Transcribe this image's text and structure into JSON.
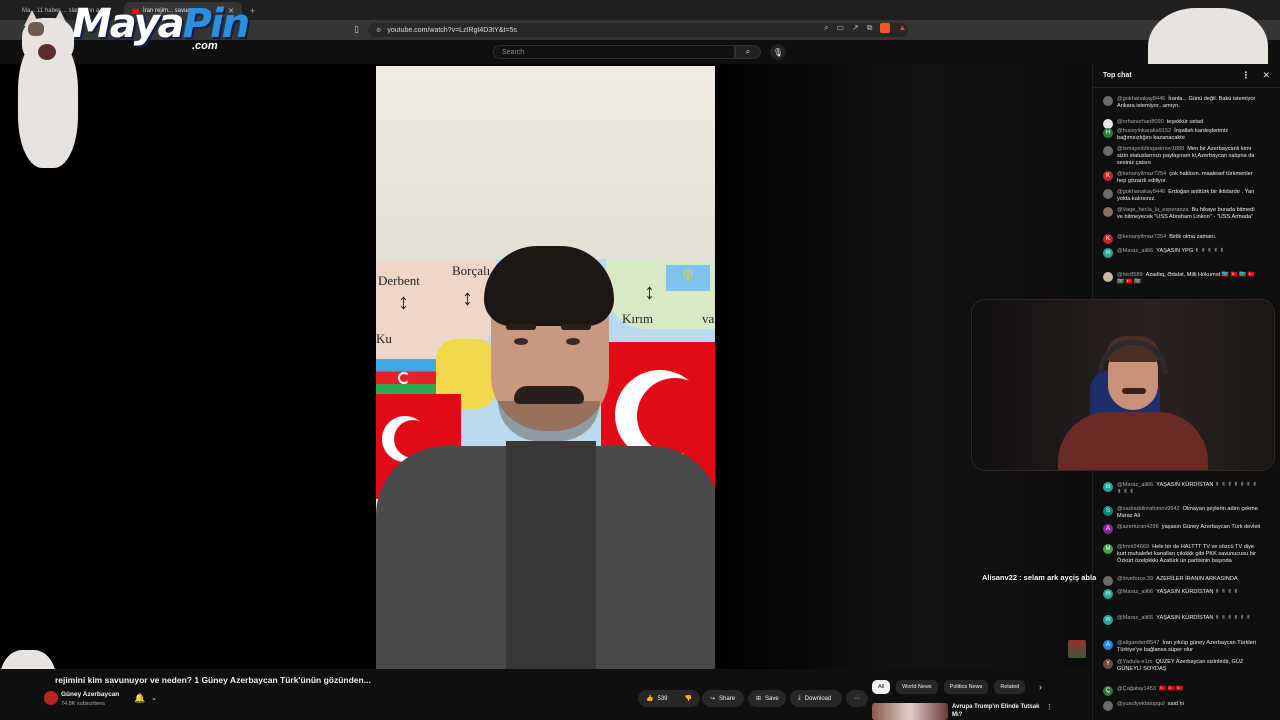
{
  "browser": {
    "tabs": [
      {
        "label": "Ma... 11 haber ... slam alan a..."
      },
      {
        "label": "İran rejim... savunuyor v..."
      }
    ],
    "new_tab": "+",
    "url": "youtube.com/watch?v=LzIRgt4D3tY&t=5s"
  },
  "overlay": {
    "logo_main": "Maya",
    "logo_accent": "Pin",
    "logo_sub": ".com",
    "alert_text": "Alisanv22 : selam ark ayçiş abla"
  },
  "youtube": {
    "search_placeholder": "Search",
    "video": {
      "map_labels": [
        "Derbent",
        "Borçalı",
        "Kırım",
        "Ku",
        "va"
      ]
    },
    "title": "rejimini kim savunuyor ve neden? 1 Güney Azerbaycan Türk'ünün gözünden...",
    "channel_name": "Güney Azerbaycan",
    "subscribers": "74.8K subscribers",
    "like_count": "539",
    "share_label": "Share",
    "save_label": "Save",
    "download_label": "Download",
    "more_label": "⋯",
    "chips": [
      "All",
      "World News",
      "Politics News",
      "Related"
    ],
    "rec_title": "Avrupa Trump'ın Elinde Tutsak Mı?"
  },
  "chat": {
    "header": "Top chat",
    "messages": [
      {
        "author": "@gokhanakay8446",
        "text": "İranla... Günü değil. Bakü istemiyor Ankara istemiyor...amıyn.",
        "color": "#6b6b6b",
        "initial": ""
      },
      {
        "author": "@orhanorhan8090",
        "text": "teşekkür ustad",
        "color": "#e8e8e8",
        "initial": ""
      },
      {
        "author": "@huseyinkaraka9152",
        "text": "İnşallah kardeşlerimiz bağımsızlığını kazanacaktır.",
        "color": "#2e7d32",
        "initial": "H"
      },
      {
        "author": "@ismayeddinqasimov1888",
        "text": "Men bir Azerbaycanlı kimi sizin statuslarınızı paylaşıram ki,Azerbaycan xalqına da sesiniz çatsın",
        "color": "#6b6b6b",
        "initial": ""
      },
      {
        "author": "@kenanyilmaz7254",
        "text": "çok haklısın. maalesef türkmenler hep gözardı ediliyor.",
        "color": "#c62828",
        "initial": "K"
      },
      {
        "author": "@gokhanakay8446",
        "text": "Erdoğan antitürk bir iktidardır . Yan yolda kalırsınız.",
        "color": "#6b6b6b",
        "initial": ""
      },
      {
        "author": "@Vaqe_hecla_la_esperanza",
        "text": "Bu hikaye burada bitmedi ve bitmeyecek \"USS Abraham Linkon\" - \"USS Armada\"",
        "color": "#8d6e63",
        "initial": ""
      },
      {
        "author": "@kenanyilmaz7254",
        "text": "Birlik olma zamanı.",
        "color": "#c62828",
        "initial": "K"
      },
      {
        "author": "@Maraz_ali66",
        "text": "YAŞASIN YPG ✌ ✌ ✌ ✌ ✌",
        "color": "#26a69a",
        "initial": "m"
      },
      {
        "author": "@htc8589",
        "text": "Azadlıq, Ədalət, Milli Hökumət 🇦🇿 🇹🇷 🇦🇿 🇹🇷 🇦🇿 🇹🇷 🇦🇿",
        "color": "#c9b89a",
        "initial": ""
      },
      {
        "author": "@Maraz_ali66",
        "text": "YAŞASIN KÜRDİSTAN ✌ ✌ ✌ ✌ ✌ ✌ ✌ ✌ ✌ ✌",
        "color": "#26a69a",
        "initial": "m"
      },
      {
        "author": "@sadraddinrahimov9542",
        "text": "Olmayan şeylerin adını çekme Maraz Ali",
        "color": "#00897b",
        "initial": "S"
      },
      {
        "author": "@azerturan4296",
        "text": "yaşasın Güney Azerbaycan Türk devleti",
        "color": "#8e24aa",
        "initial": "A"
      },
      {
        "author": "@fmnt24669",
        "text": "Hele bir de HALTTT TV ve sözcü TV diye kurt muhalefet kanalları çıkıkkk gibi PKK savunucusu bir Özkürt özelpkkkı Azatürk ün partisinin başında",
        "color": "#43a047",
        "initial": "M"
      },
      {
        "author": "@loveforce.39",
        "text": "AZERİLER İRANIN ARKASINDA",
        "color": "#6b6b6b",
        "initial": ""
      },
      {
        "author": "@Maraz_ali66",
        "text": "YAŞASIN KÜRDİSTAN ✌ ✌ ✌ ✌",
        "color": "#26a69a",
        "initial": "m"
      },
      {
        "author": "@Maraz_ali66",
        "text": "YAŞASIN KÜRDİSTAN ✌ ✌ ✌ ✌ ✌ ✌",
        "color": "#26a69a",
        "initial": "m"
      },
      {
        "author": "@aliganden8547",
        "text": "İran yıkılıp güney Azerbaycan Türkleri Türkiye'ye bağlansa süper olur",
        "color": "#1e88e5",
        "initial": "A"
      },
      {
        "author": "@Yadula-e1m",
        "text": "QUZEY Azerbaycan sizinledir, GÜZ GÜNEYLİ SOYDAŞ",
        "color": "#6d4c41",
        "initial": "Y"
      },
      {
        "author": "@Çağatay1453",
        "text": "🇹🇷 🇹🇷 🇹🇷",
        "color": "#2e7d32",
        "initial": "Ç"
      },
      {
        "author": "@yusufyektatopgul",
        "text": "said hi",
        "color": "#6b6b6b",
        "initial": ""
      }
    ]
  }
}
